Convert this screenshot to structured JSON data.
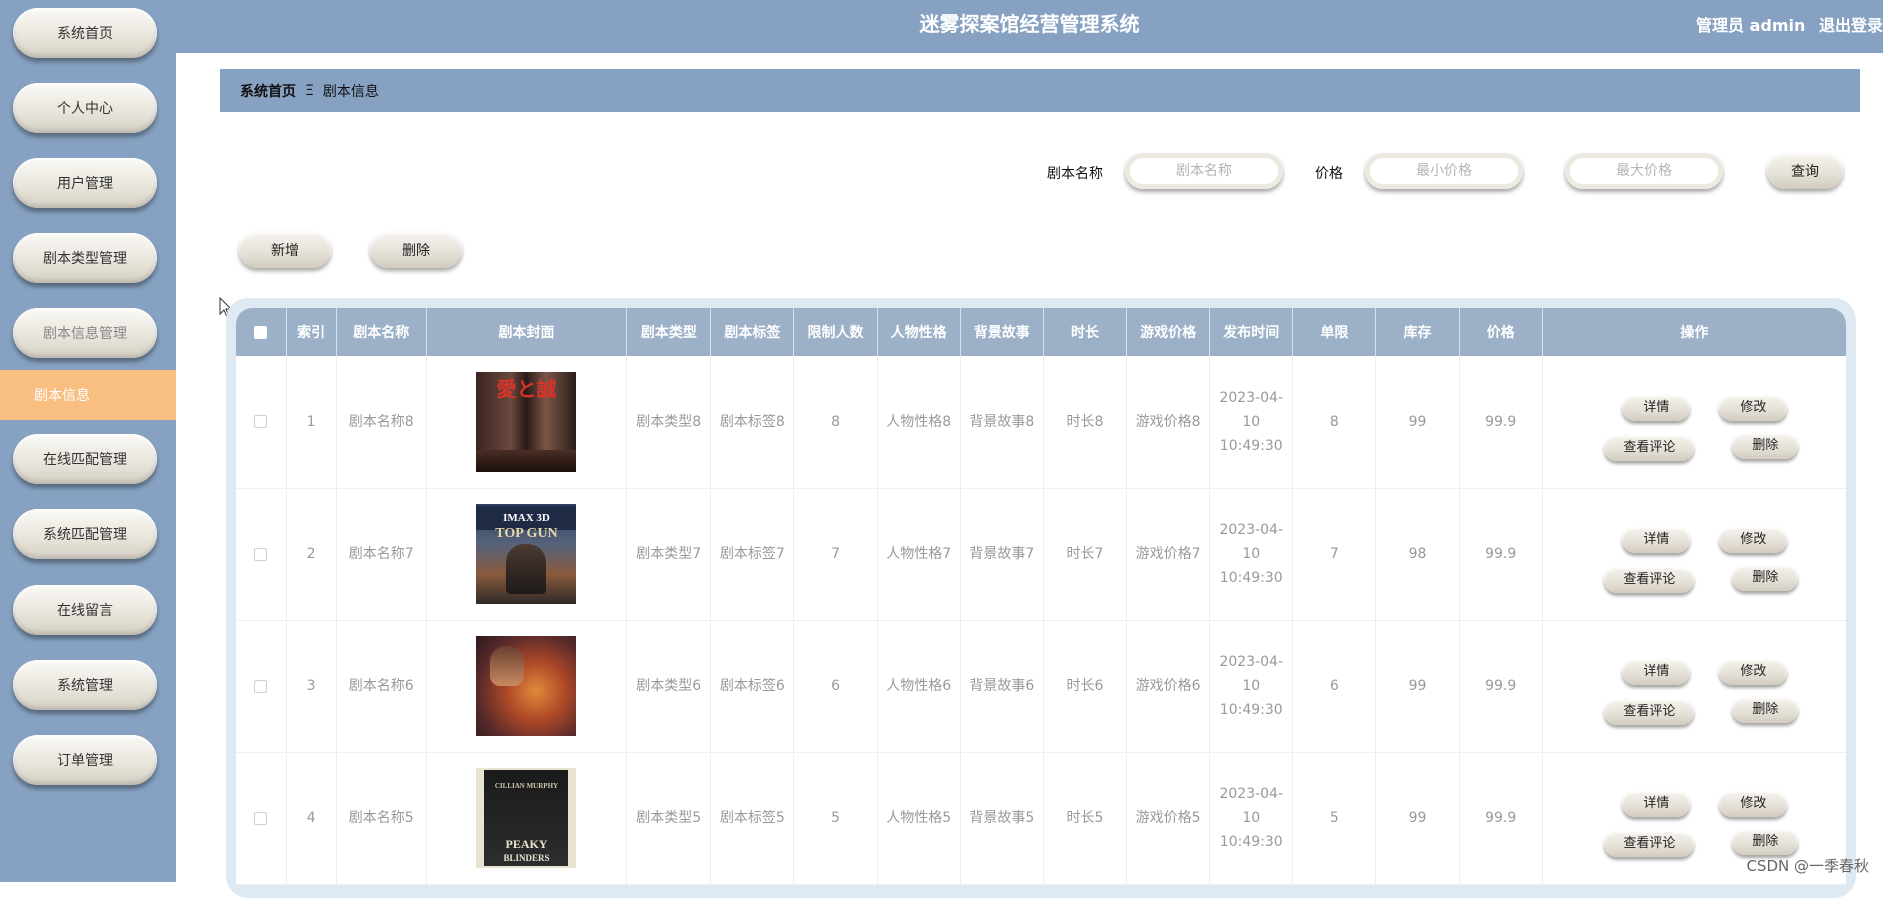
{
  "header": {
    "title": "迷雾探案馆经营管理系统",
    "role": "管理员 admin",
    "logout": "退出登录"
  },
  "sidebar": {
    "items": [
      {
        "label": "系统首页"
      },
      {
        "label": "个人中心"
      },
      {
        "label": "用户管理"
      },
      {
        "label": "剧本类型管理"
      },
      {
        "label": "剧本信息管理"
      },
      {
        "label": "在线匹配管理"
      },
      {
        "label": "系统匹配管理"
      },
      {
        "label": "在线留言"
      },
      {
        "label": "系统管理"
      },
      {
        "label": "订单管理"
      }
    ],
    "active_sub": "剧本信息"
  },
  "breadcrumb": {
    "home": "系统首页",
    "sep": "Ξ",
    "current": "剧本信息"
  },
  "search": {
    "name_label": "剧本名称",
    "name_placeholder": "剧本名称",
    "price_label": "价格",
    "min_placeholder": "最小价格",
    "max_placeholder": "最大价格",
    "query_button": "查询"
  },
  "toolbar": {
    "add_button": "新增",
    "delete_button": "删除"
  },
  "table": {
    "headers": [
      "索引",
      "剧本名称",
      "剧本封面",
      "剧本类型",
      "剧本标签",
      "限制人数",
      "人物性格",
      "背景故事",
      "时长",
      "游戏价格",
      "发布时间",
      "单限",
      "库存",
      "价格",
      "操作"
    ],
    "rows": [
      {
        "index": "1",
        "name": "剧本名称8",
        "cover": "poster-1",
        "type": "剧本类型8",
        "tag": "剧本标签8",
        "limit": "8",
        "character": "人物性格8",
        "story": "背景故事8",
        "duration": "时长8",
        "game_price": "游戏价格8",
        "time": "2023-04-10 10:49:30",
        "single": "8",
        "stock": "99",
        "price": "99.9"
      },
      {
        "index": "2",
        "name": "剧本名称7",
        "cover": "poster-2",
        "type": "剧本类型7",
        "tag": "剧本标签7",
        "limit": "7",
        "character": "人物性格7",
        "story": "背景故事7",
        "duration": "时长7",
        "game_price": "游戏价格7",
        "time": "2023-04-10 10:49:30",
        "single": "7",
        "stock": "98",
        "price": "99.9"
      },
      {
        "index": "3",
        "name": "剧本名称6",
        "cover": "poster-3",
        "type": "剧本类型6",
        "tag": "剧本标签6",
        "limit": "6",
        "character": "人物性格6",
        "story": "背景故事6",
        "duration": "时长6",
        "game_price": "游戏价格6",
        "time": "2023-04-10 10:49:30",
        "single": "6",
        "stock": "99",
        "price": "99.9"
      },
      {
        "index": "4",
        "name": "剧本名称5",
        "cover": "poster-4",
        "type": "剧本类型5",
        "tag": "剧本标签5",
        "limit": "5",
        "character": "人物性格5",
        "story": "背景故事5",
        "duration": "时长5",
        "game_price": "游戏价格5",
        "time": "2023-04-10 10:49:30",
        "single": "5",
        "stock": "99",
        "price": "99.9"
      }
    ],
    "actions": {
      "detail": "详情",
      "edit": "修改",
      "comments": "查看评论",
      "delete": "删除"
    },
    "poster_text": {
      "p1": "愛と誠",
      "p2a": "IMAX 3D",
      "p2b": "TOP GUN",
      "p4a": "CILLIAN MURPHY",
      "p4b": "PEAKY",
      "p4c": "BLINDERS"
    }
  },
  "watermark": "CSDN @一季春秋",
  "colors": {
    "sidebar": "#86a1c1",
    "active": "#f8bf80",
    "table_header": "#9cb0c8"
  }
}
